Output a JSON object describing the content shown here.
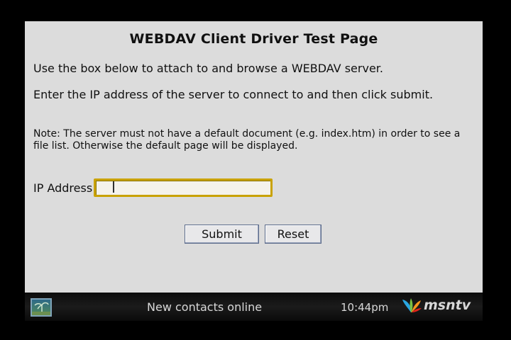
{
  "page": {
    "title": "WEBDAV Client Driver Test Page",
    "paragraph1": "Use the box below to attach to and browse a WEBDAV server.",
    "paragraph2": "Enter the IP address of the server to connect to and then click submit.",
    "note": "Note: The server must not have a default document (e.g. index.htm) in order to see a file list. Otherwise the default page will be displayed."
  },
  "form": {
    "ip_label": "IP Address",
    "ip_value": "",
    "submit_label": "Submit",
    "reset_label": "Reset"
  },
  "statusbar": {
    "message": "New contacts online",
    "time": "10:44pm",
    "logo_text": "msntv",
    "icons": [
      "tv-screen-icon",
      "msn-butterfly-icon"
    ]
  },
  "colors": {
    "page_background": "#dcdcdc",
    "input_focus_border": "#c9a200",
    "statusbar_background": "#111111",
    "butterfly": [
      "#2aa6e0",
      "#7ac143",
      "#f7941d",
      "#e2231a"
    ]
  }
}
